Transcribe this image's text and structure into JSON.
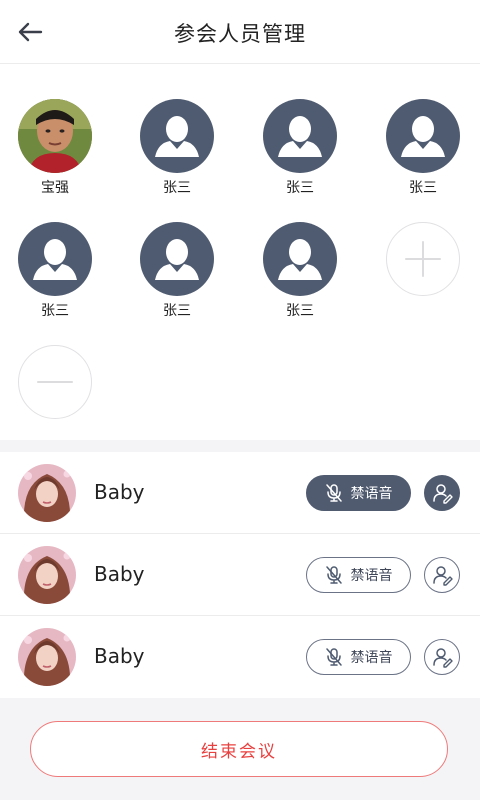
{
  "header": {
    "title": "参会人员管理",
    "back_icon": "arrow-left-icon"
  },
  "participants": [
    {
      "name": "宝强",
      "avatar": "photo"
    },
    {
      "name": "张三",
      "avatar": "default"
    },
    {
      "name": "张三",
      "avatar": "default"
    },
    {
      "name": "张三",
      "avatar": "default"
    },
    {
      "name": "张三",
      "avatar": "default"
    },
    {
      "name": "张三",
      "avatar": "default"
    },
    {
      "name": "张三",
      "avatar": "default"
    }
  ],
  "grid_actions": {
    "add_icon": "plus-icon",
    "remove_icon": "minus-icon"
  },
  "members_list": [
    {
      "name": "Baby",
      "mute_label": "禁语音",
      "muted": true,
      "user_active": true
    },
    {
      "name": "Baby",
      "mute_label": "禁语音",
      "muted": false,
      "user_active": false
    },
    {
      "name": "Baby",
      "mute_label": "禁语音",
      "muted": false,
      "user_active": false
    }
  ],
  "footer": {
    "end_label": "结束会议"
  },
  "colors": {
    "accent_dark": "#505b70",
    "danger": "#e8403f",
    "background": "#f4f4f6"
  }
}
